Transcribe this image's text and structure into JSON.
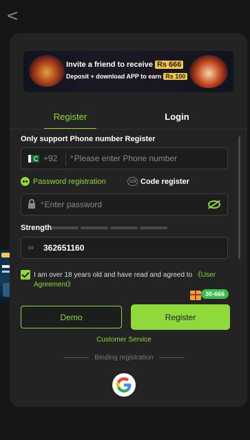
{
  "nav": {
    "back_glyph": "<"
  },
  "banner": {
    "line1_text": "Invite a friend to receive",
    "line1_highlight": "Rs 666",
    "line2_text": "Deposit + download APP to earn",
    "line2_highlight": "Rs 100"
  },
  "tabs": [
    {
      "label": "Register",
      "active": true
    },
    {
      "label": "Login",
      "active": false
    }
  ],
  "form": {
    "support_note": "Only support Phone number Register",
    "phone": {
      "country_code": "+92",
      "required_mark": "*",
      "placeholder": "Please enter Phone number"
    },
    "modes": {
      "password": "Password registration",
      "code": "Code register",
      "code_icon": "123"
    },
    "password": {
      "required_mark": "*",
      "placeholder": "Enter password"
    },
    "strength_label": "Strength",
    "strength_level": 0,
    "strength_segments": 4,
    "invite_code_value": "362651160",
    "agreement": {
      "checked": true,
      "text": "I am over 18 years old and have read and agreed to ",
      "link": "《User Agreement》"
    }
  },
  "buttons": {
    "demo": "Demo",
    "register": "Register",
    "badge": "30-666"
  },
  "footer": {
    "customer_service": "Customer Service",
    "binding": "Binding registration"
  },
  "colors": {
    "accent": "#8fd93a",
    "background": "#161616",
    "panel": "#232323",
    "field": "#1d1d1d"
  },
  "icons": {
    "back": "chevron-left-icon",
    "flag": "pakistan-flag-icon",
    "lock": "lock-icon",
    "eye": "eye-off-icon",
    "hand": "handshake-icon",
    "gift": "gift-icon",
    "google": "google-icon"
  }
}
